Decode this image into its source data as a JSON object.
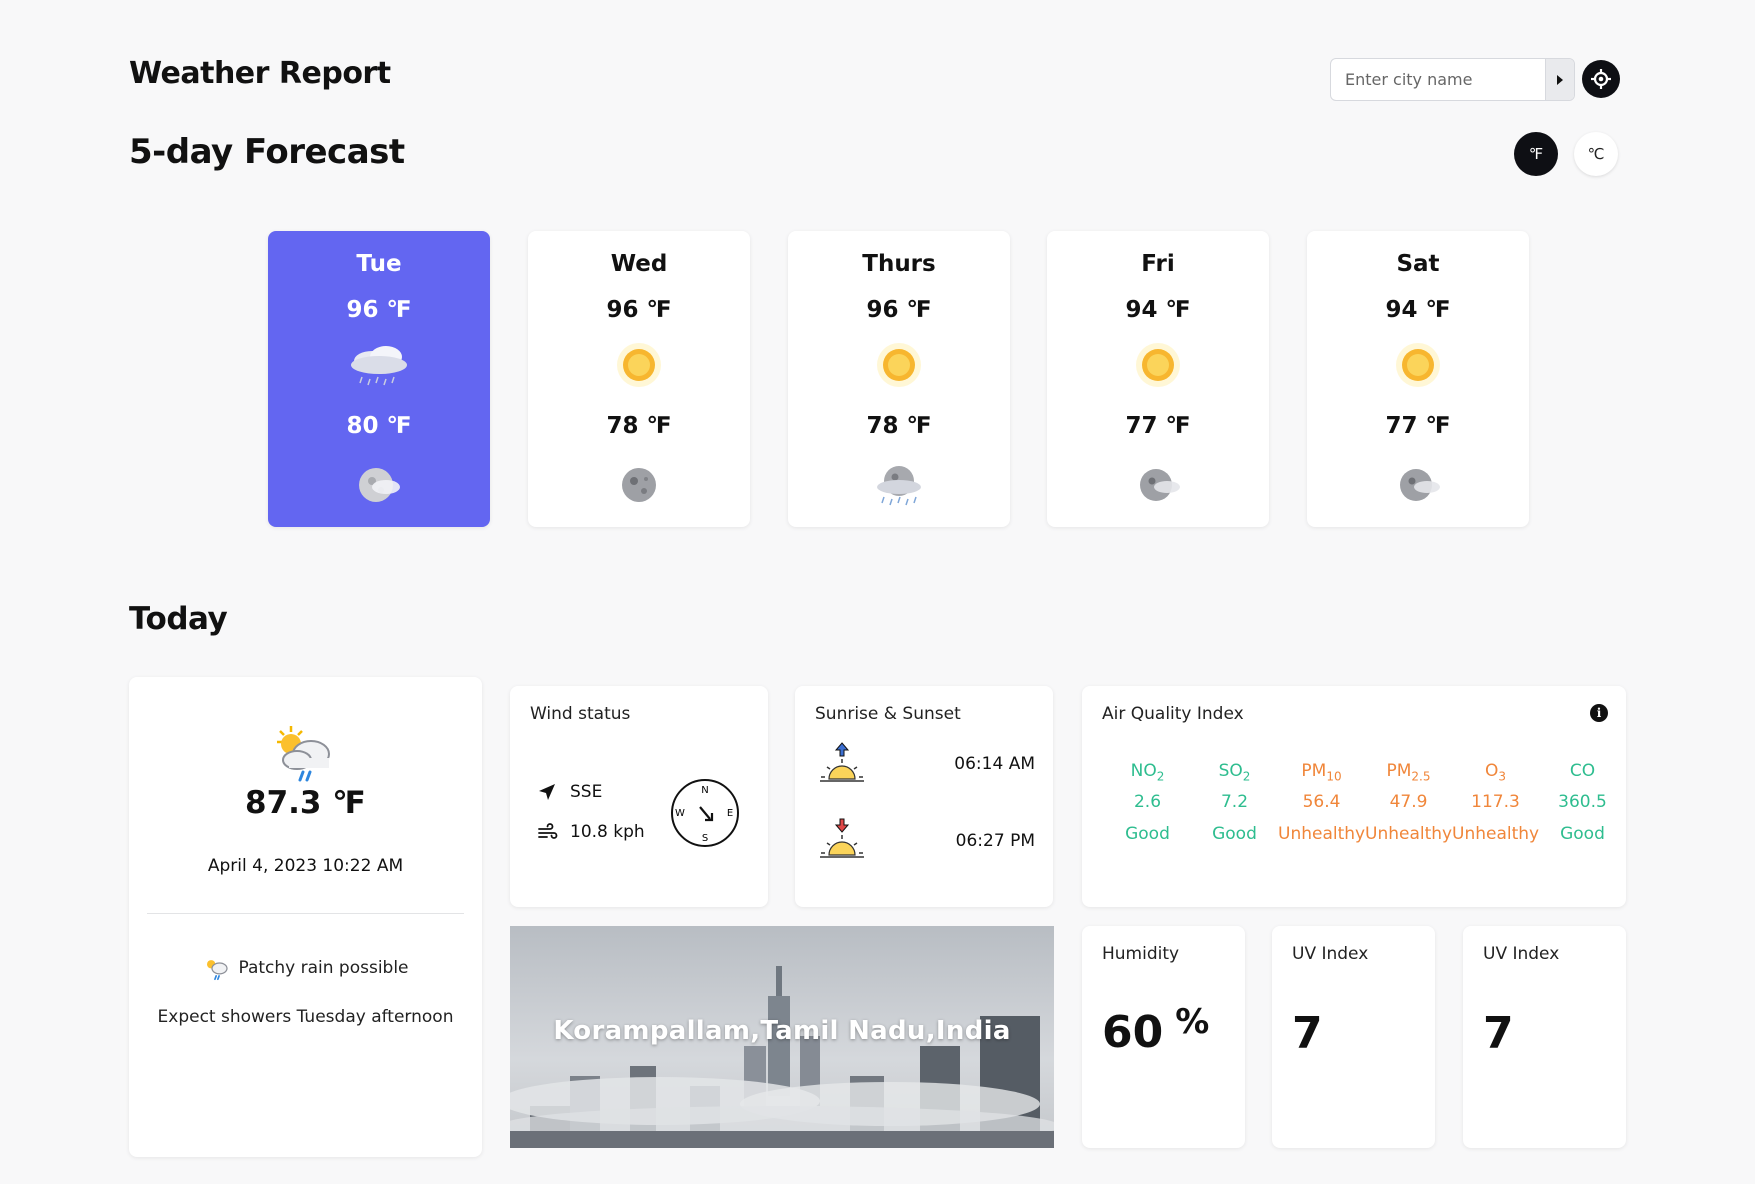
{
  "header": {
    "app_title": "Weather Report",
    "search_placeholder": "Enter city name",
    "search_submit_icon": "triangle-right-icon",
    "locate_icon": "crosshair-icon"
  },
  "forecast": {
    "title": "5-day Forecast",
    "unit_f": "℉",
    "unit_c": "℃",
    "active_unit": "F",
    "days": [
      {
        "day": "Tue",
        "max": "96 ℉",
        "min": "80 ℉",
        "day_icon": "cloud-rain-icon",
        "night_icon": "moon-cloud-icon",
        "active": true
      },
      {
        "day": "Wed",
        "max": "96 ℉",
        "min": "78 ℉",
        "day_icon": "sun-icon",
        "night_icon": "moon-icon",
        "active": false
      },
      {
        "day": "Thurs",
        "max": "96 ℉",
        "min": "78 ℉",
        "day_icon": "sun-icon",
        "night_icon": "moon-rain-icon",
        "active": false
      },
      {
        "day": "Fri",
        "max": "94 ℉",
        "min": "77 ℉",
        "day_icon": "sun-icon",
        "night_icon": "moon-cloud-icon",
        "active": false
      },
      {
        "day": "Sat",
        "max": "94 ℉",
        "min": "77 ℉",
        "day_icon": "sun-icon",
        "night_icon": "moon-cloud-icon",
        "active": false
      }
    ]
  },
  "today": {
    "title": "Today",
    "current": {
      "icon": "sun-cloud-rain-icon",
      "temp": "87.3 ℉",
      "datetime": "April 4, 2023 10:22 AM",
      "condition": "Patchy rain possible",
      "note": "Expect showers Tuesday afternoon"
    },
    "wind": {
      "label": "Wind status",
      "direction": "SSE",
      "speed": "10.8 kph",
      "compass_n": "N",
      "compass_e": "E",
      "compass_s": "S",
      "compass_w": "W"
    },
    "sun": {
      "label": "Sunrise & Sunset",
      "sunrise": "06:14 AM",
      "sunset": "06:27 PM"
    },
    "aqi": {
      "label": "Air Quality Index",
      "good_color": "#2ebd8f",
      "bad_color": "#f0863a",
      "items": [
        {
          "name": "NO",
          "sub": "2",
          "value": "2.6",
          "status": "Good"
        },
        {
          "name": "SO",
          "sub": "2",
          "value": "7.2",
          "status": "Good"
        },
        {
          "name": "PM",
          "sub": "10",
          "value": "56.4",
          "status": "Unhealthy"
        },
        {
          "name": "PM",
          "sub": "2.5",
          "value": "47.9",
          "status": "Unhealthy"
        },
        {
          "name": "O",
          "sub": "3",
          "value": "117.3",
          "status": "Unhealthy"
        },
        {
          "name": "CO",
          "sub": "",
          "value": "360.5",
          "status": "Good"
        }
      ]
    },
    "location": "Korampallam,Tamil Nadu,India",
    "humidity": {
      "label": "Humidity",
      "value": "60",
      "unit": "%"
    },
    "uv1": {
      "label": "UV Index",
      "value": "7"
    },
    "uv2": {
      "label": "UV Index",
      "value": "7"
    }
  },
  "colors": {
    "accent": "#6366f1",
    "dark": "#0e0f14",
    "background": "#f8f8f9"
  }
}
